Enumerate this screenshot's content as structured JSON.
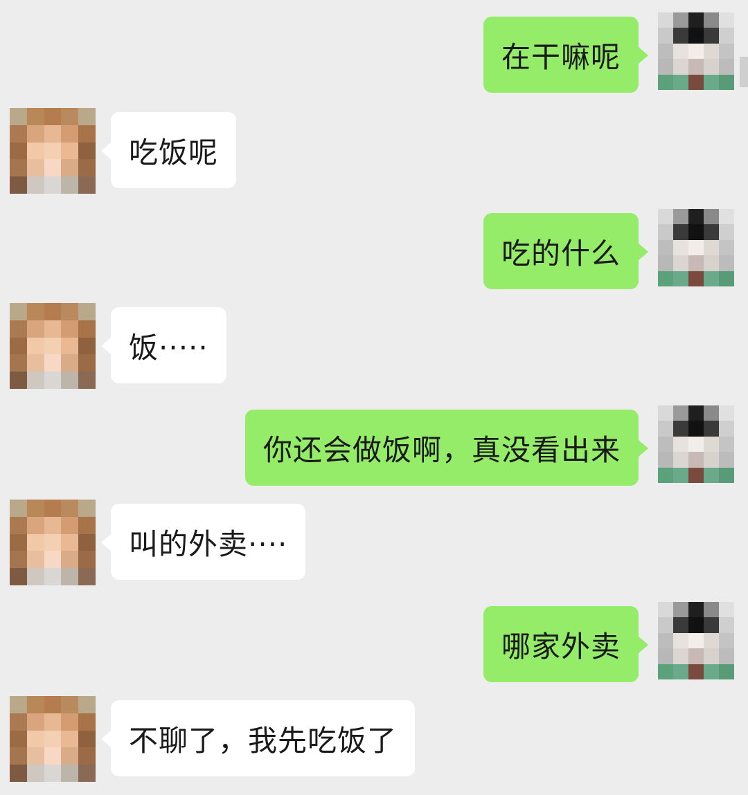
{
  "conversation": {
    "messages": [
      {
        "sender": "me",
        "text": "在干嘛呢",
        "avatar_icon": "pixelated-avatar-boy-icon"
      },
      {
        "sender": "other",
        "text": "吃饭呢",
        "avatar_icon": "pixelated-avatar-girl-icon"
      },
      {
        "sender": "me",
        "text": "吃的什么",
        "avatar_icon": "pixelated-avatar-boy-icon"
      },
      {
        "sender": "other",
        "text": "饭·····",
        "avatar_icon": "pixelated-avatar-girl-icon"
      },
      {
        "sender": "me",
        "text": "你还会做饭啊，真没看出来",
        "avatar_icon": "pixelated-avatar-boy-icon"
      },
      {
        "sender": "other",
        "text": "叫的外卖····",
        "avatar_icon": "pixelated-avatar-girl-icon"
      },
      {
        "sender": "me",
        "text": "哪家外卖",
        "avatar_icon": "pixelated-avatar-boy-icon"
      },
      {
        "sender": "other",
        "text": "不聊了，我先吃饭了",
        "avatar_icon": "pixelated-avatar-girl-icon"
      }
    ]
  },
  "colors": {
    "background": "#ededed",
    "my_bubble": "#95ec69",
    "other_bubble": "#ffffff",
    "text": "#1a1a1a"
  }
}
